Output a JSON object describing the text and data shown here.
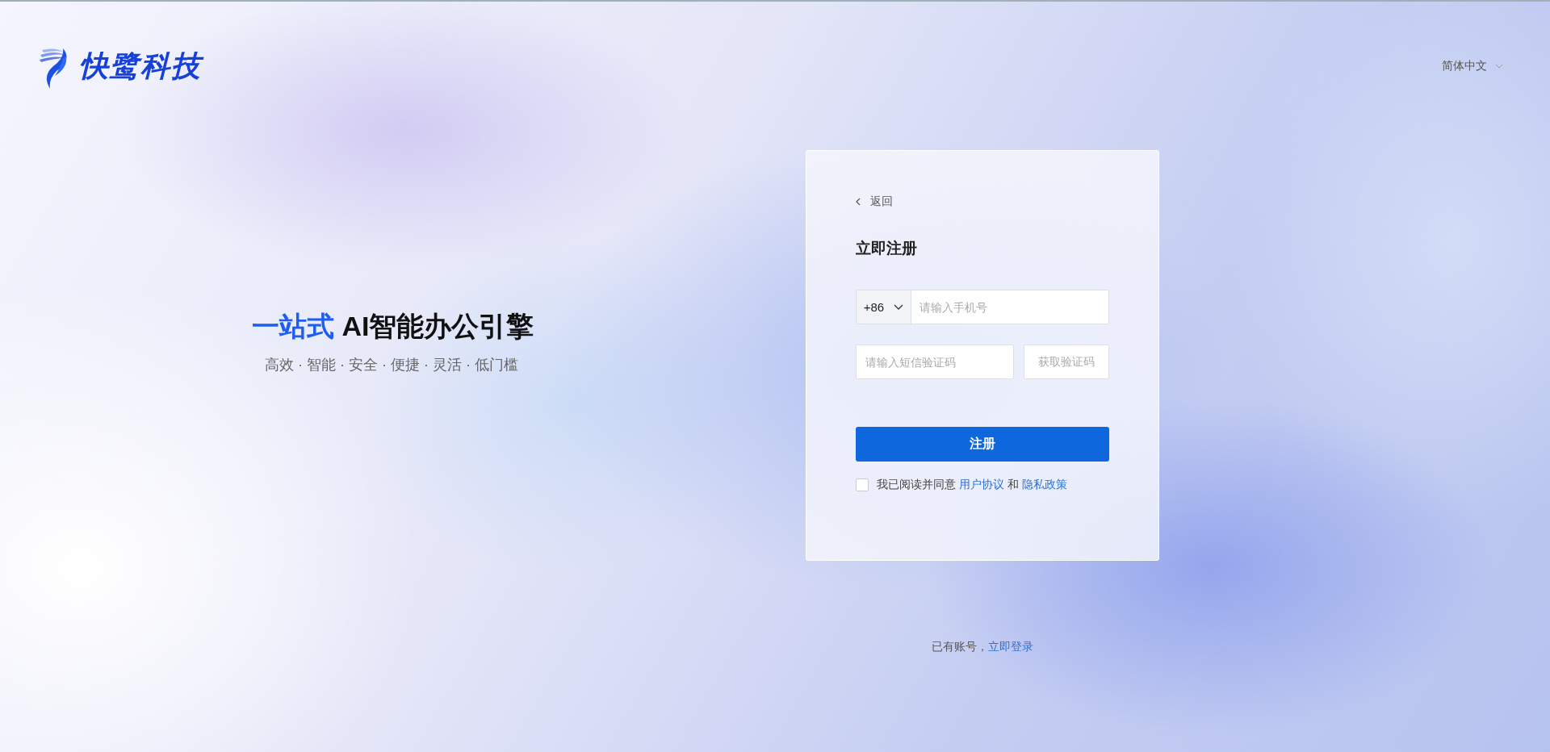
{
  "header": {
    "logo_text": "快鹭科技",
    "language": "简体中文"
  },
  "hero": {
    "headline_accent": "一站式",
    "headline": "AI智能办公引擎",
    "tagline": "高效 · 智能 · 安全 · 便捷 · 灵活 · 低门槛"
  },
  "form": {
    "back": "返回",
    "title": "立即注册",
    "country_code": "+86",
    "phone_placeholder": "请输入手机号",
    "code_placeholder": "请输入短信验证码",
    "get_code": "获取验证码",
    "submit": "注册",
    "agreement": {
      "checked": false,
      "text": "我已阅读并同意",
      "link_1": "用户协议",
      "joiner": "和",
      "link_2": "隐私政策"
    }
  },
  "footer": {
    "text": "已有账号，",
    "link": "立即登录"
  }
}
